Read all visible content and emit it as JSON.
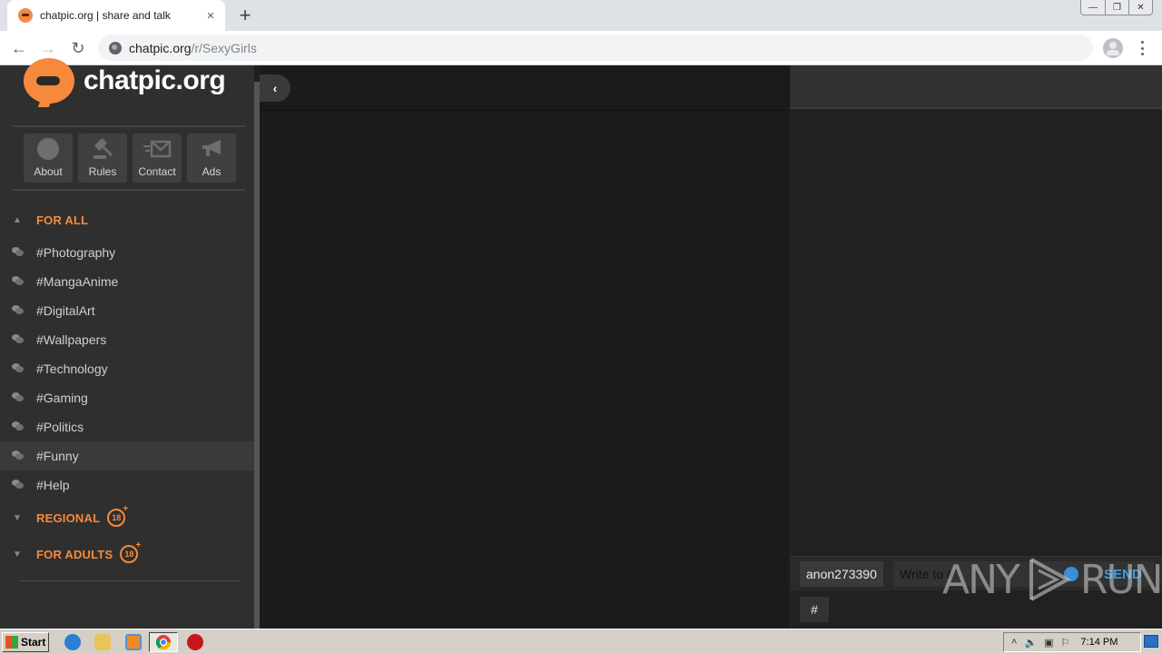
{
  "browser": {
    "tab": {
      "title": "chatpic.org | share and talk",
      "close_icon": "×"
    },
    "new_tab_icon": "+",
    "window_controls": {
      "minimize": "—",
      "restore": "❐",
      "close": "✕"
    },
    "nav": {
      "back": "←",
      "forward": "→",
      "reload": "↻"
    },
    "url": {
      "host": "chatpic.org",
      "path": "/r/SexyGirls"
    },
    "menu_icon": "⋮"
  },
  "sidebar": {
    "logo_text": "chatpic.org",
    "quick_buttons": [
      {
        "label": "About",
        "icon": "info-bubble-icon"
      },
      {
        "label": "Rules",
        "icon": "gavel-icon"
      },
      {
        "label": "Contact",
        "icon": "envelope-icon"
      },
      {
        "label": "Ads",
        "icon": "megaphone-icon"
      }
    ],
    "sections": [
      {
        "label": "FOR ALL",
        "expanded": true,
        "adult_badge": false
      },
      {
        "label": "REGIONAL",
        "expanded": false,
        "adult_badge": true,
        "badge_text": "18"
      },
      {
        "label": "FOR ADULTS",
        "expanded": false,
        "adult_badge": true,
        "badge_text": "18"
      }
    ],
    "channels": [
      {
        "label": "#Photography"
      },
      {
        "label": "#MangaAnime"
      },
      {
        "label": "#DigitalArt"
      },
      {
        "label": "#Wallpapers"
      },
      {
        "label": "#Technology"
      },
      {
        "label": "#Gaming"
      },
      {
        "label": "#Politics"
      },
      {
        "label": "#Funny",
        "highlighted": true
      },
      {
        "label": "#Help"
      }
    ],
    "caret_up": "▲",
    "caret_down": "▼"
  },
  "center": {
    "collapse_icon": "‹"
  },
  "chat": {
    "nickname": "anon273390",
    "input_placeholder": "Write to #",
    "send_label": "SEND",
    "hash_label": "#"
  },
  "watermark": {
    "left": "ANY",
    "right": "RUN"
  },
  "taskbar": {
    "start_label": "Start",
    "clock": "7:14 PM",
    "tray_icons": [
      "show-hidden-icon",
      "volume-icon",
      "network-warning-icon",
      "flag-icon"
    ]
  },
  "colors": {
    "accent": "#f58a3c",
    "send": "#3a9be0",
    "sidebar_bg": "#2f2f2f",
    "main_bg": "#1b1b1b"
  }
}
